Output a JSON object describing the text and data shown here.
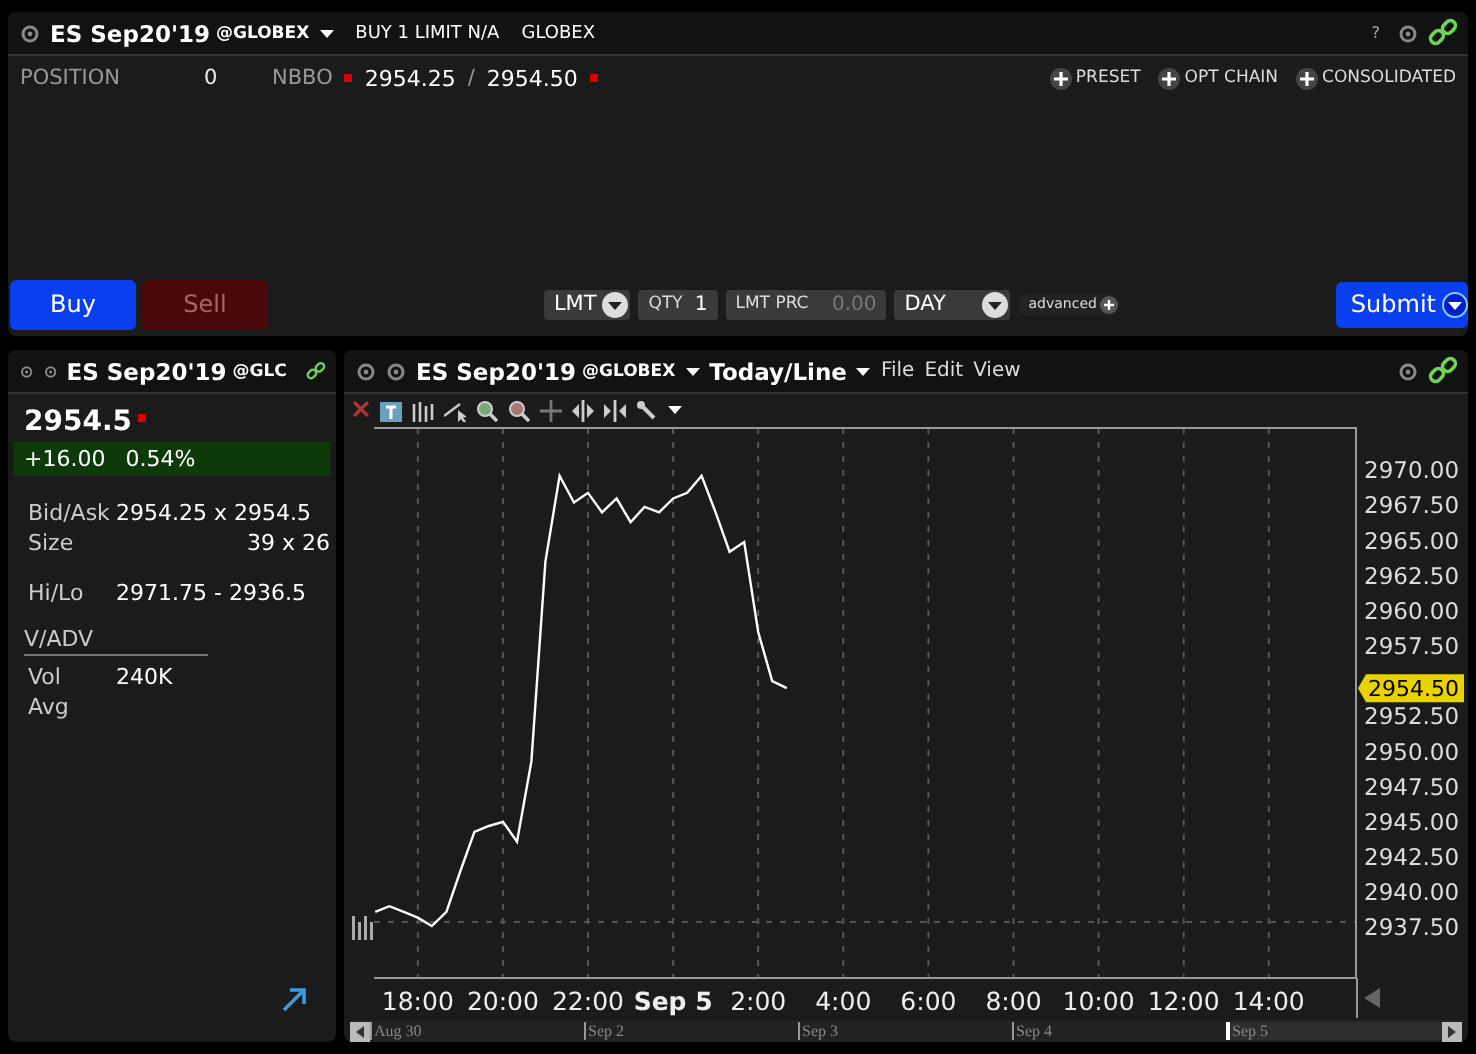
{
  "order_panel": {
    "header": {
      "symbol": "ES Sep20'19",
      "exchange": "@GLOBEX",
      "order_summary": "BUY 1 LIMIT N/A",
      "route": "GLOBEX",
      "help": "?"
    },
    "position": {
      "label": "POSITION",
      "value": "0"
    },
    "nbbo": {
      "label": "NBBO",
      "bid": "2954.25",
      "separator": "/",
      "ask": "2954.50"
    },
    "links": [
      "PRESET",
      "OPT CHAIN",
      "CONSOLIDATED"
    ],
    "sides": [
      {
        "label": "Buy",
        "selected": true
      },
      {
        "label": "Sell",
        "selected": false
      }
    ],
    "order_type": "LMT",
    "qty": {
      "label": "QTY",
      "value": "1"
    },
    "limit_price": {
      "label": "LMT PRC",
      "placeholder": "0.00"
    },
    "tif": "DAY",
    "advanced": "advanced",
    "submit": "Submit"
  },
  "quote_panel": {
    "header": {
      "symbol": "ES Sep20'19",
      "exchange": "@GLC"
    },
    "last": "2954.5",
    "change": "+16.00",
    "change_pct": "0.54%",
    "rows": [
      {
        "label": "Bid/Ask",
        "value": "2954.25 x 2954.5"
      },
      {
        "label": "Size",
        "value": "39 x 26"
      },
      {
        "label": "Hi/Lo",
        "value": "2971.75 - 2936.5"
      }
    ],
    "section": "V/ADV",
    "volume_rows": [
      {
        "label": "Vol",
        "value": "240K"
      },
      {
        "label": "Avg"
      }
    ]
  },
  "chart_panel": {
    "header": {
      "symbol": "ES Sep20'19",
      "exchange": "@GLOBEX",
      "view": "Today/Line"
    },
    "menu": [
      "File",
      "Edit",
      "View"
    ],
    "last_price_tag": "2954.50",
    "time_axis": [
      {
        "label": "Sep 5",
        "kind": "date"
      },
      {
        "label": "2:00",
        "kind": "time"
      },
      {
        "label": "4:00",
        "kind": "time"
      },
      {
        "label": "6:00",
        "kind": "time"
      },
      {
        "label": "8:00",
        "kind": "time"
      },
      {
        "label": "10:00",
        "kind": "time"
      },
      {
        "label": "12:00",
        "kind": "time"
      },
      {
        "label": "14:00",
        "kind": "time"
      }
    ],
    "chart_data": {
      "type": "line",
      "grid": true,
      "x": [
        17,
        17.33,
        17.67,
        18,
        18.33,
        18.67,
        19,
        19.33,
        19.67,
        20,
        20.33,
        20.67,
        21,
        21.33,
        21.67,
        22,
        22.33,
        22.67,
        23,
        23.33,
        23.67,
        24,
        24.33,
        24.67,
        25,
        25.33,
        25.67,
        26,
        26.33,
        26.67
      ],
      "series": [
        {
          "color": "#ffffff",
          "values": [
            2938.6,
            2939,
            2938.6,
            2938.2,
            2937.6,
            2938.6,
            2941.5,
            2944.3,
            2944.7,
            2945,
            2943.6,
            2949.3,
            2963.5,
            2969.6,
            2967.7,
            2968.4,
            2967,
            2968,
            2966.3,
            2967.4,
            2967,
            2968,
            2968.4,
            2969.6,
            2967,
            2964.2,
            2964.9,
            2958.5,
            2955,
            2954.5
          ]
        }
      ],
      "xlim": [
        16.97,
        40.05
      ],
      "ylim": [
        2933.9,
        2973
      ],
      "xticks": [
        {
          "value": 18,
          "label": "18:00"
        },
        {
          "value": 20,
          "label": "20:00"
        },
        {
          "value": 22,
          "label": "22:00"
        }
      ],
      "yticks": [
        {
          "value": 2937.5,
          "label": "2937.50"
        },
        {
          "value": 2940,
          "label": "2940.00"
        },
        {
          "value": 2942.5,
          "label": "2942.50"
        },
        {
          "value": 2945,
          "label": "2945.00"
        },
        {
          "value": 2947.5,
          "label": "2947.50"
        },
        {
          "value": 2950,
          "label": "2950.00"
        },
        {
          "value": 2952.5,
          "label": "2952.50"
        },
        {
          "value": 2957.5,
          "label": "2957.50"
        },
        {
          "value": 2960,
          "label": "2960.00"
        },
        {
          "value": 2962.5,
          "label": "2962.50"
        },
        {
          "value": 2965,
          "label": "2965.00"
        },
        {
          "value": 2967.5,
          "label": "2967.50"
        },
        {
          "value": 2970,
          "label": "2970.00"
        }
      ]
    },
    "navigator": [
      "Aug 30",
      "Sep 2",
      "Sep 3",
      "Sep 4",
      "Sep 5"
    ]
  }
}
